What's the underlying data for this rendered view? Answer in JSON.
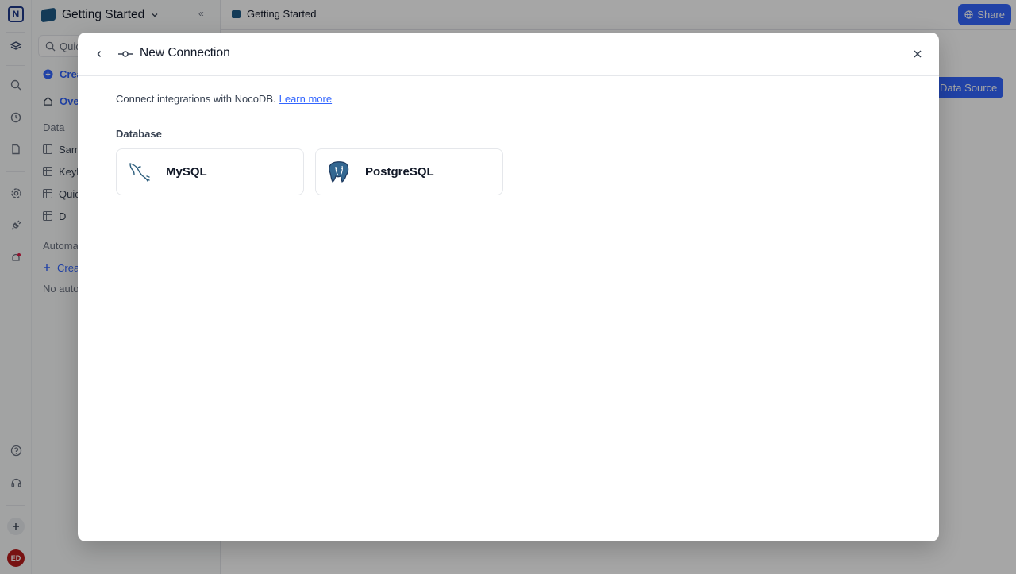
{
  "app": {
    "logo_text": "N",
    "avatar_initials": "ED"
  },
  "sidebar": {
    "workspace_title": "Getting Started",
    "search_placeholder": "Quic",
    "create_label": "Crea",
    "overview_label": "Ove",
    "data_section": "Data",
    "tables": [
      "Sam",
      "Keyl",
      "Quic",
      "D"
    ],
    "automations_section": "Automa",
    "create_automation": "Crea",
    "no_automations": "No auto"
  },
  "topbar": {
    "breadcrumb": "Getting Started",
    "share_label": "Share"
  },
  "main": {
    "data_source_button": "Data Source"
  },
  "modal": {
    "title": "New Connection",
    "intro_text": "Connect integrations with NocoDB.",
    "learn_more": "Learn more",
    "database_label": "Database",
    "options": [
      {
        "name": "MySQL",
        "icon": "mysql-dolphin-icon"
      },
      {
        "name": "PostgreSQL",
        "icon": "postgresql-elephant-icon"
      }
    ]
  },
  "colors": {
    "accent": "#3366ff",
    "overlay": "rgba(0,0,0,0.35)",
    "brand_dark": "#1f3a8a"
  }
}
